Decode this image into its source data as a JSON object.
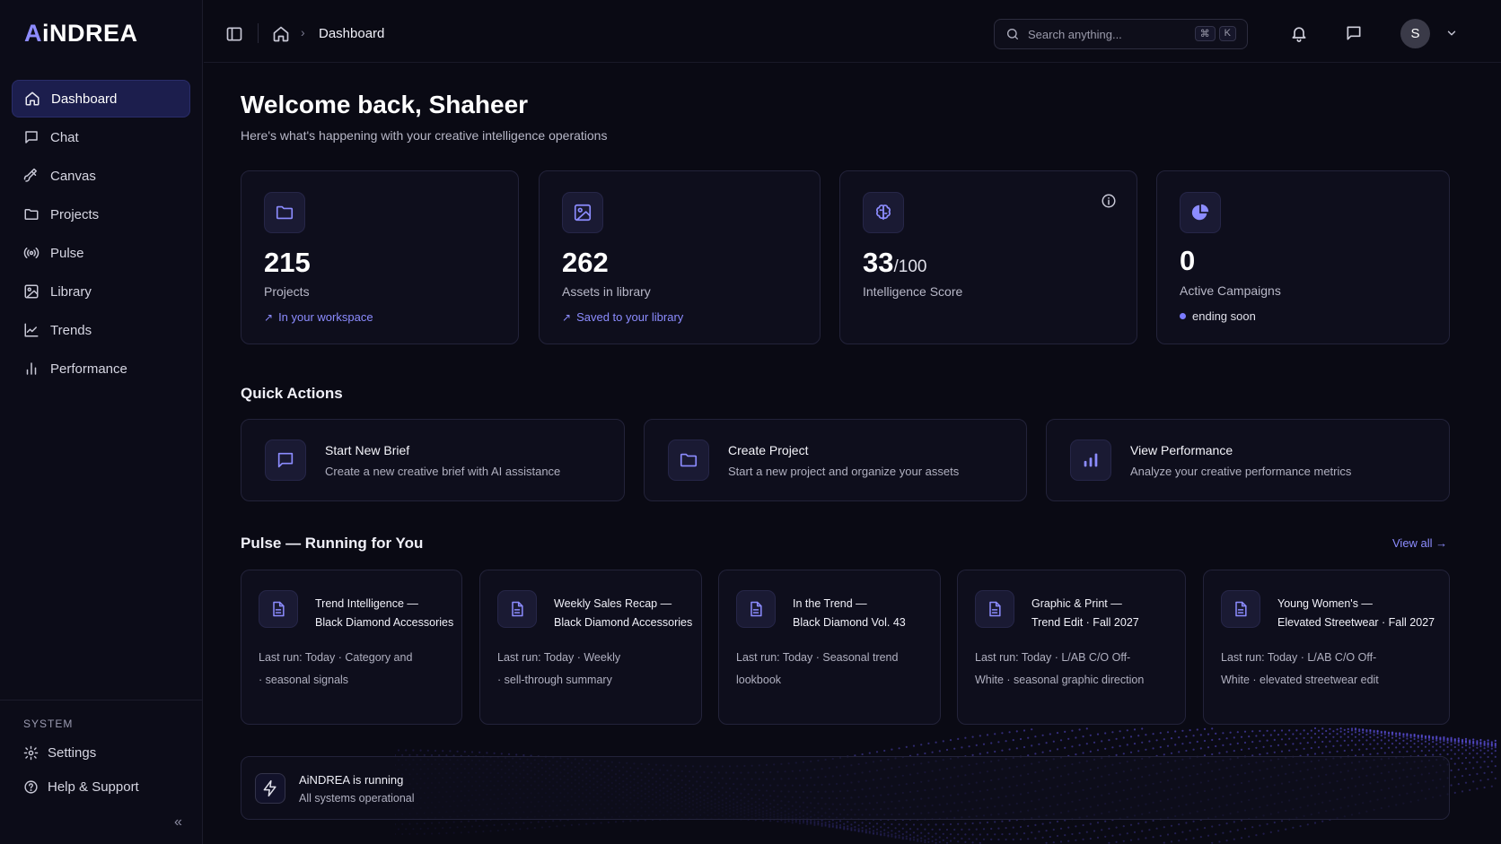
{
  "brand": {
    "logo_a": "A",
    "logo_i": "i",
    "logo_rest": "NDREA"
  },
  "sidebar": {
    "items": [
      {
        "label": "Dashboard",
        "icon": "home-icon",
        "active": true
      },
      {
        "label": "Chat",
        "icon": "chat-icon"
      },
      {
        "label": "Canvas",
        "icon": "brush-icon"
      },
      {
        "label": "Projects",
        "icon": "folder-icon"
      },
      {
        "label": "Pulse",
        "icon": "broadcast-icon"
      },
      {
        "label": "Library",
        "icon": "image-icon"
      },
      {
        "label": "Trends",
        "icon": "line-chart-icon"
      },
      {
        "label": "Performance",
        "icon": "bar-chart-icon"
      }
    ],
    "system_label": "SYSTEM",
    "settings_label": "Settings",
    "help_label": "Help & Support",
    "collapse_glyph": "«"
  },
  "topbar": {
    "breadcrumb_current": "Dashboard",
    "search_placeholder": "Search anything...",
    "search_kbd_1": "⌘",
    "search_kbd_2": "K",
    "avatar_initial": "S"
  },
  "header": {
    "title": "Welcome back, Shaheer",
    "subtitle": "Here's what's happening with your creative intelligence operations"
  },
  "stats": [
    {
      "value": "215",
      "label": "Projects",
      "sub": "In your workspace",
      "icon": "folder-icon"
    },
    {
      "value": "262",
      "label": "Assets in library",
      "sub": "Saved to your library",
      "icon": "image-icon"
    },
    {
      "value": "33",
      "suffix": "/100",
      "label": "Intelligence Score",
      "icon": "brain-icon"
    },
    {
      "value": "0",
      "label": "Active Campaigns",
      "sub": "ending soon",
      "icon": "pie-icon"
    }
  ],
  "quick_actions": {
    "title": "Quick Actions",
    "items": [
      {
        "title": "Start New Brief",
        "desc": "Create a new creative brief with AI assistance",
        "icon": "chat-icon"
      },
      {
        "title": "Create Project",
        "desc": "Start a new project and organize your assets",
        "icon": "folder-icon"
      },
      {
        "title": "View Performance",
        "desc": "Analyze your creative performance metrics",
        "icon": "bar-chart-icon"
      }
    ]
  },
  "pulse": {
    "title": "Pulse — Running for You",
    "view_all": "View all →",
    "items": [
      {
        "title_1": "Trend Intelligence —",
        "title_2": "Black Diamond Accessories",
        "desc_1": "Last run: Today · Category and",
        "desc_2": "· seasonal signals"
      },
      {
        "title_1": "Weekly Sales Recap —",
        "title_2": "Black Diamond Accessories",
        "desc_1": "Last run: Today · Weekly",
        "desc_2": "· sell-through summary"
      },
      {
        "title_1": "In the Trend —",
        "title_2": "Black Diamond Vol. 43",
        "desc_1": "Last run: Today · Seasonal trend",
        "desc_2": "lookbook"
      },
      {
        "title_1": "Graphic & Print —",
        "title_2": "Trend Edit · Fall 2027",
        "desc_1": "Last run: Today · L/AB C/O Off-",
        "desc_2": "White · seasonal graphic direction"
      },
      {
        "title_1": "Young Women's —",
        "title_2": "Elevated Streetwear · Fall 2027",
        "desc_1": "Last run: Today · L/AB C/O Off-",
        "desc_2": "White · elevated streetwear edit"
      }
    ]
  },
  "status": {
    "title": "AiNDREA is running",
    "desc": "All systems operational"
  },
  "colors": {
    "accent": "#8c8cff",
    "active_nav": "#1c1e4d",
    "background": "#0a0a14"
  }
}
